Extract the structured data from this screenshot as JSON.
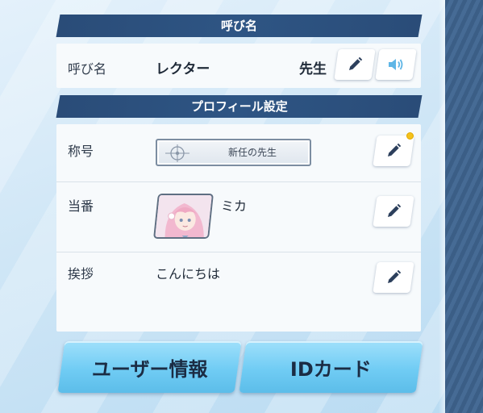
{
  "nickname_section": {
    "header": "呼び名",
    "label": "呼び名",
    "name_value": "レクター",
    "honorific": "先生"
  },
  "profile_section": {
    "header": "プロフィール設定",
    "rows": [
      {
        "label": "称号",
        "value": "新任の先生"
      },
      {
        "label": "当番",
        "value": "ミカ"
      },
      {
        "label": "挨拶",
        "value": "こんにちは"
      }
    ]
  },
  "buttons": {
    "user_info": "ユーザー情報",
    "id_card": "IDカード"
  },
  "colors": {
    "header_bg": "#2a4c78",
    "panel_bg": "#f7fafc",
    "button_blue": "#70ccf4",
    "notif_dot": "#f5c21b",
    "edit_icon": "#2c3f5c",
    "speaker_icon": "#5fb6e6"
  },
  "icons": {
    "edit": "pencil-icon",
    "voice": "speaker-icon",
    "badge": "crosshair-crest-icon"
  }
}
